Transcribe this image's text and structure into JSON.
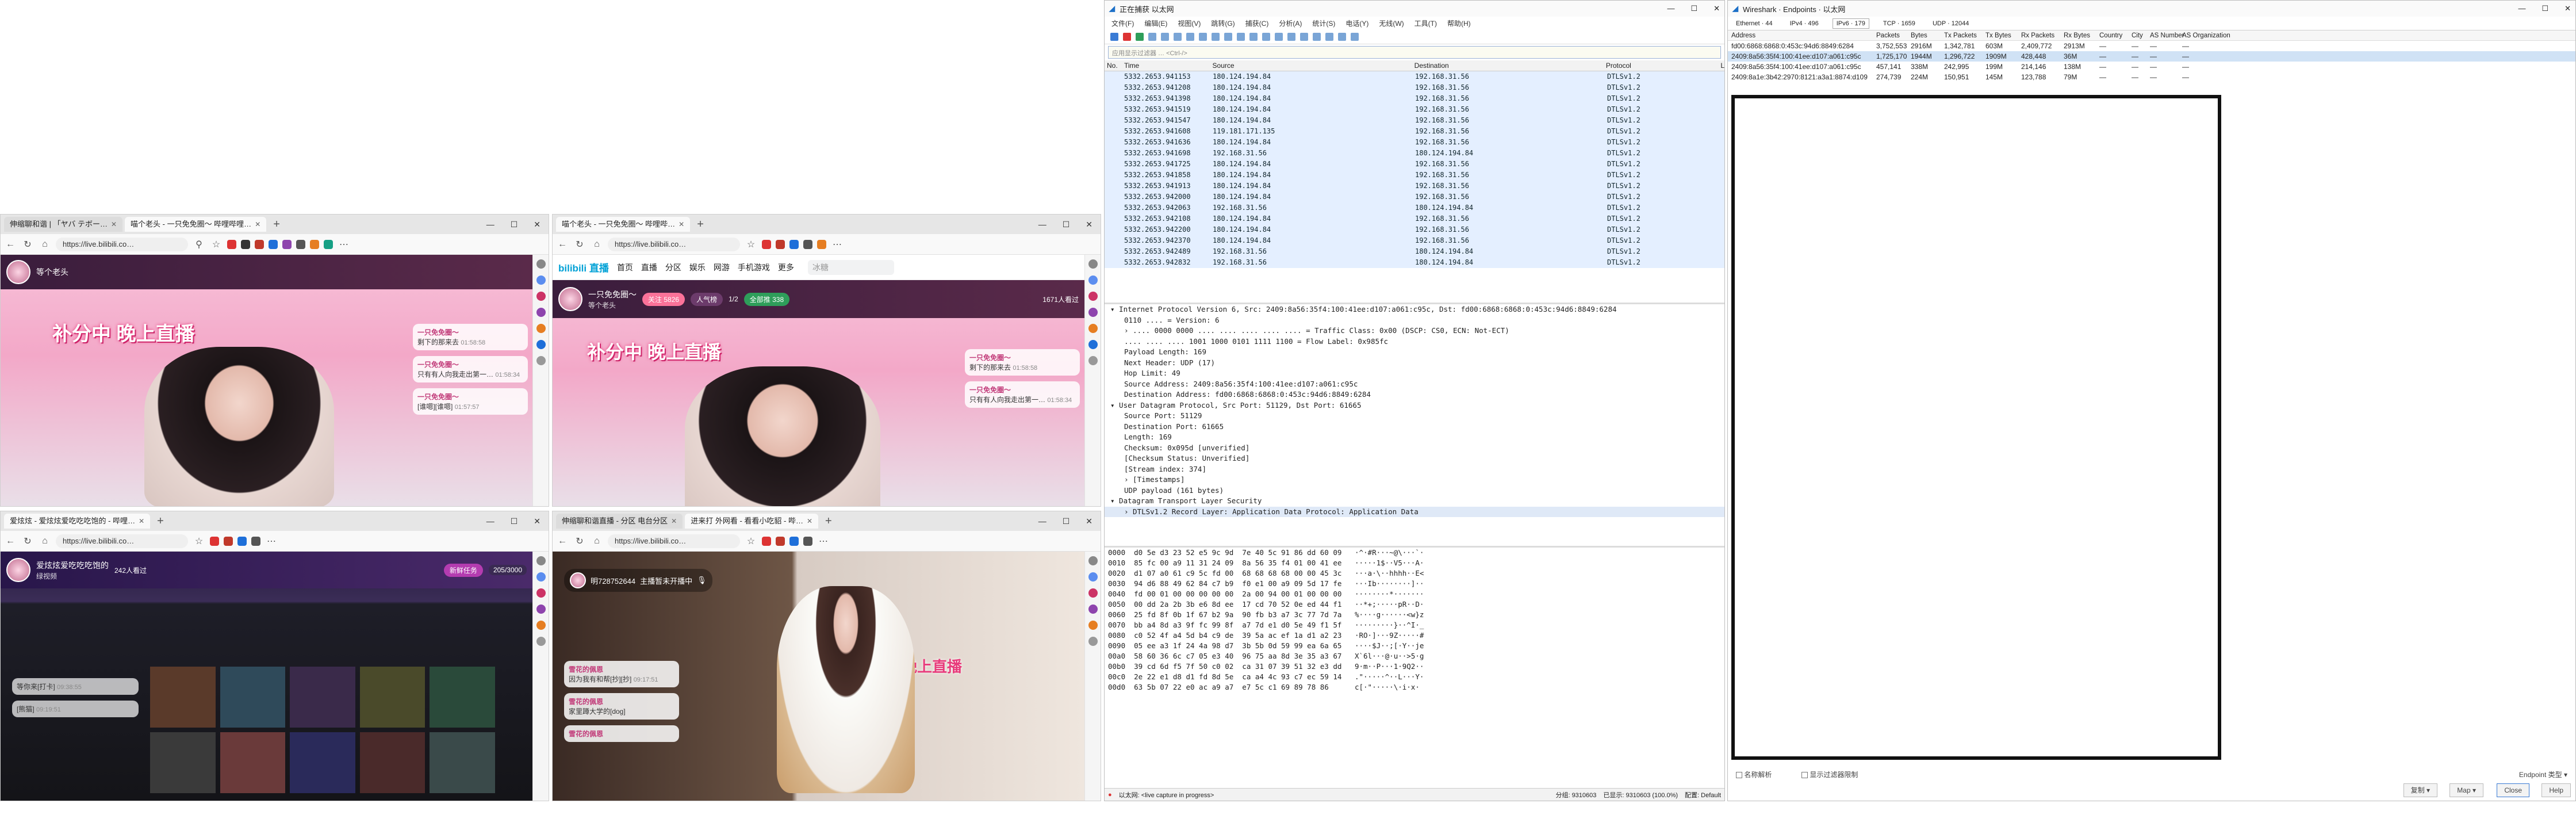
{
  "browsers": [
    {
      "tabs": [
        "伸缩聊和谐 | 「ヤバ テボー…",
        "喵个老头 - 一只免免圈～ 哔哩哔哩…"
      ],
      "url": "https://live.bilibili.co…",
      "room_name": "等个老头",
      "live_badge": "",
      "banner": "补分中 晚上直播",
      "chat": [
        {
          "name": "一只免免圈～",
          "text": "剩下的那来去",
          "time": "01:58:58"
        },
        {
          "name": "一只免免圈～",
          "text": "只有有人向我走出第一…",
          "time": "01:58:34"
        },
        {
          "name": "一只免免圈～",
          "text": "[谁嗯][谁嗯]",
          "time": "01:57:57"
        }
      ]
    },
    {
      "tabs": [
        "喵个老头 - 一只免免圈～ 哔哩哔…"
      ],
      "url": "https://live.bilibili.co…",
      "nav": [
        "首页",
        "直播",
        "分区",
        "娱乐",
        "网游",
        "手机游戏",
        "更多"
      ],
      "search_placeholder": "冰糖",
      "room_name": "一只免免圈～",
      "sub_name": "等个老头",
      "viewers": "1671人看过",
      "follow_label": "关注",
      "follow_count": "5826",
      "like_label": "人气榜",
      "rank_text": "1/2",
      "gift_label": "全部推",
      "gift_count": "338",
      "banner": "补分中 晚上直播",
      "chat": [
        {
          "name": "一只免免圈～",
          "text": "剩下的那来去",
          "time": "01:58:58"
        },
        {
          "name": "一只免免圈～",
          "text": "只有有人向我走出第一…",
          "time": "01:58:34"
        }
      ]
    },
    {
      "tabs": [
        "爱炫炫 - 爱炫炫爱吃吃吃饱的 - 哔哩…"
      ],
      "url": "https://live.bilibili.co…",
      "room_name": "爱炫炫爱吃吃吃饱的",
      "sub_name": "绿视频",
      "viewers": "242人看过",
      "task_label": "新鲜任务",
      "task_progress": "205/3000",
      "chat": [
        {
          "name": "",
          "text": "等你来[打卡]",
          "time": "09:38:55"
        },
        {
          "name": "",
          "text": "[熊猫]",
          "time": "09:19:51"
        }
      ]
    },
    {
      "tabs": [
        "伸缩聊和谐直播 - 分区 电台分区",
        "进来打 外网看 - 看看小吃貂 - 哔…"
      ],
      "url": "https://live.bilibili.co…",
      "room_name": "明728752644",
      "status": "主播暂未开播中",
      "banner": "欢迎来到直播间，晚上直播",
      "chat": [
        {
          "name": "雪花的佩恩",
          "text": "因为我有和帮[抄][抄]",
          "time": "09:17:51"
        },
        {
          "name": "雪花的佩恩",
          "text": "家里蹲大学的[dog]",
          "time": ""
        },
        {
          "name": "雪花的佩恩",
          "text": "",
          "time": ""
        }
      ]
    }
  ],
  "wireshark": {
    "title": "正在捕获 以太网",
    "menu": [
      "文件(F)",
      "编辑(E)",
      "视图(V)",
      "跳转(G)",
      "捕获(C)",
      "分析(A)",
      "统计(S)",
      "电话(Y)",
      "无线(W)",
      "工具(T)",
      "帮助(H)"
    ],
    "filter_placeholder": "应用显示过滤器 … <Ctrl-/>",
    "columns": [
      "No.",
      "Time",
      "Source",
      "Destination",
      "Protocol",
      "L"
    ],
    "packets": [
      {
        "no": "",
        "time": "5332.2653.941153",
        "src": "180.124.194.84",
        "dst": "192.168.31.56",
        "proto": "DTLSv1.2"
      },
      {
        "no": "",
        "time": "5332.2653.941208",
        "src": "180.124.194.84",
        "dst": "192.168.31.56",
        "proto": "DTLSv1.2"
      },
      {
        "no": "",
        "time": "5332.2653.941398",
        "src": "180.124.194.84",
        "dst": "192.168.31.56",
        "proto": "DTLSv1.2"
      },
      {
        "no": "",
        "time": "5332.2653.941519",
        "src": "180.124.194.84",
        "dst": "192.168.31.56",
        "proto": "DTLSv1.2"
      },
      {
        "no": "",
        "time": "5332.2653.941547",
        "src": "180.124.194.84",
        "dst": "192.168.31.56",
        "proto": "DTLSv1.2"
      },
      {
        "no": "",
        "time": "5332.2653.941608",
        "src": "119.181.171.135",
        "dst": "192.168.31.56",
        "proto": "DTLSv1.2"
      },
      {
        "no": "",
        "time": "5332.2653.941636",
        "src": "180.124.194.84",
        "dst": "192.168.31.56",
        "proto": "DTLSv1.2"
      },
      {
        "no": "",
        "time": "5332.2653.941698",
        "src": "192.168.31.56",
        "dst": "180.124.194.84",
        "proto": "DTLSv1.2"
      },
      {
        "no": "",
        "time": "5332.2653.941725",
        "src": "180.124.194.84",
        "dst": "192.168.31.56",
        "proto": "DTLSv1.2"
      },
      {
        "no": "",
        "time": "5332.2653.941858",
        "src": "180.124.194.84",
        "dst": "192.168.31.56",
        "proto": "DTLSv1.2"
      },
      {
        "no": "",
        "time": "5332.2653.941913",
        "src": "180.124.194.84",
        "dst": "192.168.31.56",
        "proto": "DTLSv1.2"
      },
      {
        "no": "",
        "time": "5332.2653.942000",
        "src": "180.124.194.84",
        "dst": "192.168.31.56",
        "proto": "DTLSv1.2"
      },
      {
        "no": "",
        "time": "5332.2653.942063",
        "src": "192.168.31.56",
        "dst": "180.124.194.84",
        "proto": "DTLSv1.2"
      },
      {
        "no": "",
        "time": "5332.2653.942108",
        "src": "180.124.194.84",
        "dst": "192.168.31.56",
        "proto": "DTLSv1.2"
      },
      {
        "no": "",
        "time": "5332.2653.942200",
        "src": "180.124.194.84",
        "dst": "192.168.31.56",
        "proto": "DTLSv1.2"
      },
      {
        "no": "",
        "time": "5332.2653.942370",
        "src": "180.124.194.84",
        "dst": "192.168.31.56",
        "proto": "DTLSv1.2"
      },
      {
        "no": "",
        "time": "5332.2653.942489",
        "src": "192.168.31.56",
        "dst": "180.124.194.84",
        "proto": "DTLSv1.2"
      },
      {
        "no": "",
        "time": "5332.2653.942832",
        "src": "192.168.31.56",
        "dst": "180.124.194.84",
        "proto": "DTLSv1.2"
      }
    ],
    "details": [
      {
        "lvl": 0,
        "text": "▾ Internet Protocol Version 6, Src: 2409:8a56:35f4:100:41ee:d107:a061:c95c, Dst: fd00:6868:6868:0:453c:94d6:8849:6284"
      },
      {
        "lvl": 1,
        "text": "0110 .... = Version: 6"
      },
      {
        "lvl": 1,
        "text": "› .... 0000 0000 .... .... .... .... .... = Traffic Class: 0x00 (DSCP: CS0, ECN: Not-ECT)"
      },
      {
        "lvl": 1,
        "text": ".... .... .... 1001 1000 0101 1111 1100 = Flow Label: 0x985fc"
      },
      {
        "lvl": 1,
        "text": "Payload Length: 169"
      },
      {
        "lvl": 1,
        "text": "Next Header: UDP (17)"
      },
      {
        "lvl": 1,
        "text": "Hop Limit: 49"
      },
      {
        "lvl": 1,
        "text": "Source Address: 2409:8a56:35f4:100:41ee:d107:a061:c95c"
      },
      {
        "lvl": 1,
        "text": "Destination Address: fd00:6868:6868:0:453c:94d6:8849:6284"
      },
      {
        "lvl": 0,
        "text": "▾ User Datagram Protocol, Src Port: 51129, Dst Port: 61665"
      },
      {
        "lvl": 1,
        "text": "Source Port: 51129"
      },
      {
        "lvl": 1,
        "text": "Destination Port: 61665"
      },
      {
        "lvl": 1,
        "text": "Length: 169"
      },
      {
        "lvl": 1,
        "text": "Checksum: 0x095d [unverified]"
      },
      {
        "lvl": 1,
        "text": "[Checksum Status: Unverified]"
      },
      {
        "lvl": 1,
        "text": "[Stream index: 374]"
      },
      {
        "lvl": 1,
        "text": "› [Timestamps]"
      },
      {
        "lvl": 1,
        "text": "UDP payload (161 bytes)"
      },
      {
        "lvl": 0,
        "text": "▾ Datagram Transport Layer Security"
      },
      {
        "lvl": 1,
        "text": "› DTLSv1.2 Record Layer: Application Data Protocol: Application Data"
      }
    ],
    "hex": [
      "0000  d0 5e d3 23 52 e5 9c 9d  7e 40 5c 91 86 dd 60 09   ·^·#R···~@\\···`·",
      "0010  85 fc 00 a9 11 31 24 09  8a 56 35 f4 01 00 41 ee   ·····1$··V5···A·",
      "0020  d1 07 a0 61 c9 5c fd 00  68 68 68 68 00 00 45 3c   ···a·\\··hhhh··E<",
      "0030  94 d6 88 49 62 84 c7 b9  f0 e1 00 a9 09 5d 17 fe   ···Ib········]··",
      "0040  fd 00 01 00 00 00 00 00  2a 00 94 00 01 00 00 00   ········*·······",
      "0050  00 dd 2a 2b 3b e6 8d ee  17 cd 70 52 0e ed 44 f1   ··*+;·····pR··D·",
      "0060  25 fd 8f 0b 1f 67 b2 9a  90 fb b3 a7 3c 77 7d 7a   %····g······<w}z",
      "0070  bb a4 8d a3 9f fc 99 8f  a7 7d e1 d0 5e 49 f1 5f   ·········}··^I·_",
      "0080  c0 52 4f a4 5d b4 c9 de  39 5a ac ef 1a d1 a2 23   ·RO·]···9Z·····#",
      "0090  05 ee a3 1f 24 4a 98 d7  3b 5b 0d 59 99 ea 6a 65   ····$J··;[·Y··je",
      "00a0  58 60 36 6c c7 05 e3 40  96 75 aa 8d 3e 35 a3 67   X`6l···@·u··>5·g",
      "00b0  39 cd 6d f5 7f 50 c0 02  ca 31 07 39 51 32 e3 dd   9·m··P···1·9Q2··",
      "00c0  2e 22 e1 d8 d1 fd 8d 5e  ca a4 4c 93 c7 ec 59 14   .\"·····^··L···Y·",
      "00d0  63 5b 07 22 e0 ac a9 a7  e7 5c c1 69 89 78 86      c[·\"·····\\·i·x·"
    ],
    "status_file": "以太网: <live capture in progress>",
    "status_packets": "分组: 9310603",
    "status_displayed": "已显示: 9310603 (100.0%)",
    "status_profile": "配置: Default"
  },
  "endpoints": {
    "title": "Wireshark · Endpoints · 以太网",
    "tabs": [
      "Ethernet · 44",
      "IPv4 · 496",
      "IPv6 · 179",
      "TCP · 1659",
      "UDP · 12044"
    ],
    "columns": [
      "Address",
      "Packets",
      "Bytes",
      "Tx Packets",
      "Tx Bytes",
      "Rx Packets",
      "Rx Bytes",
      "Country",
      "City",
      "AS Number",
      "AS Organization"
    ],
    "rows": [
      {
        "addr": "fd00:6868:6868:0:453c:94d6:8849:6284",
        "packets": "3,752,553",
        "bytes": "2916M",
        "txp": "1,342,781",
        "txb": "603M",
        "rxp": "2,409,772",
        "rxb": "2913M",
        "country": "—",
        "city": "—",
        "asn": "—",
        "asorg": "—"
      },
      {
        "addr": "2409:8a56:35f4:100:41ee:d107:a061:c95c",
        "packets": "1,725,170",
        "bytes": "1944M",
        "txp": "1,296,722",
        "txb": "1909M",
        "rxp": "428,448",
        "rxb": "36M",
        "country": "—",
        "city": "—",
        "asn": "—",
        "asorg": "—"
      },
      {
        "addr": "2409:8a56:35f4:100:41ee:d107:a061:c95c",
        "packets": "457,141",
        "bytes": "338M",
        "txp": "242,995",
        "txb": "199M",
        "rxp": "214,146",
        "rxb": "138M",
        "country": "—",
        "city": "—",
        "asn": "—",
        "asorg": "—"
      },
      {
        "addr": "2409:8a1e:3b42:2970:8121:a3a1:8874:d109",
        "packets": "274,739",
        "bytes": "224M",
        "txp": "150,951",
        "txb": "145M",
        "rxp": "123,788",
        "rxb": "79M",
        "country": "—",
        "city": "—",
        "asn": "—",
        "asorg": "—"
      }
    ],
    "name_resolution": "名称解析",
    "limit_filter": "显示过滤器限制",
    "endpoint_type": "Endpoint 类型 ▾",
    "copy_button": "复制 ▾",
    "map_button": "Map ▾",
    "close_button": "Close",
    "help_button": "Help"
  }
}
